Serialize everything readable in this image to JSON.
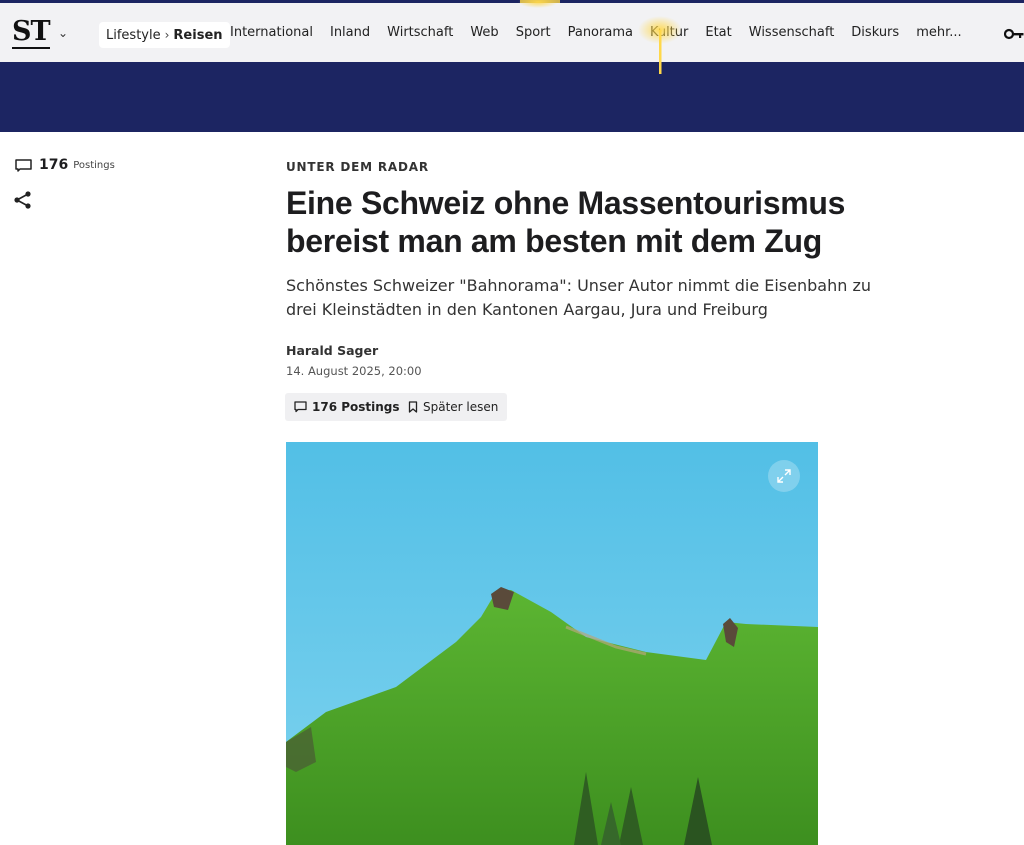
{
  "header": {
    "logo": "ST",
    "breadcrumb": {
      "parent": "Lifestyle",
      "current": "Reisen"
    },
    "nav": [
      "International",
      "Inland",
      "Wirtschaft",
      "Web",
      "Sport",
      "Panorama",
      "Kultur",
      "Etat",
      "Wissenschaft",
      "Diskurs",
      "mehr..."
    ]
  },
  "rail": {
    "postings_count": "176",
    "postings_label": "Postings"
  },
  "article": {
    "kicker": "UNTER DEM RADAR",
    "headline": "Eine Schweiz ohne Massentourismus bereist man am besten mit dem Zug",
    "lede": "Schönstes Schweizer \"Bahnorama\": Unser Autor nimmt die Eisenbahn zu drei Kleinstädten in den Kantonen Aargau, Jura und Freiburg",
    "author": "Harald Sager",
    "date": "14. August 2025, 20:00",
    "buttons": {
      "postings": "176 Postings",
      "read_later": "Später lesen"
    }
  },
  "colors": {
    "brand_navy": "#1c2562",
    "nav_bg": "#f2f2f4",
    "sky": "#5cc3e4",
    "grass": "#4fa82a"
  }
}
